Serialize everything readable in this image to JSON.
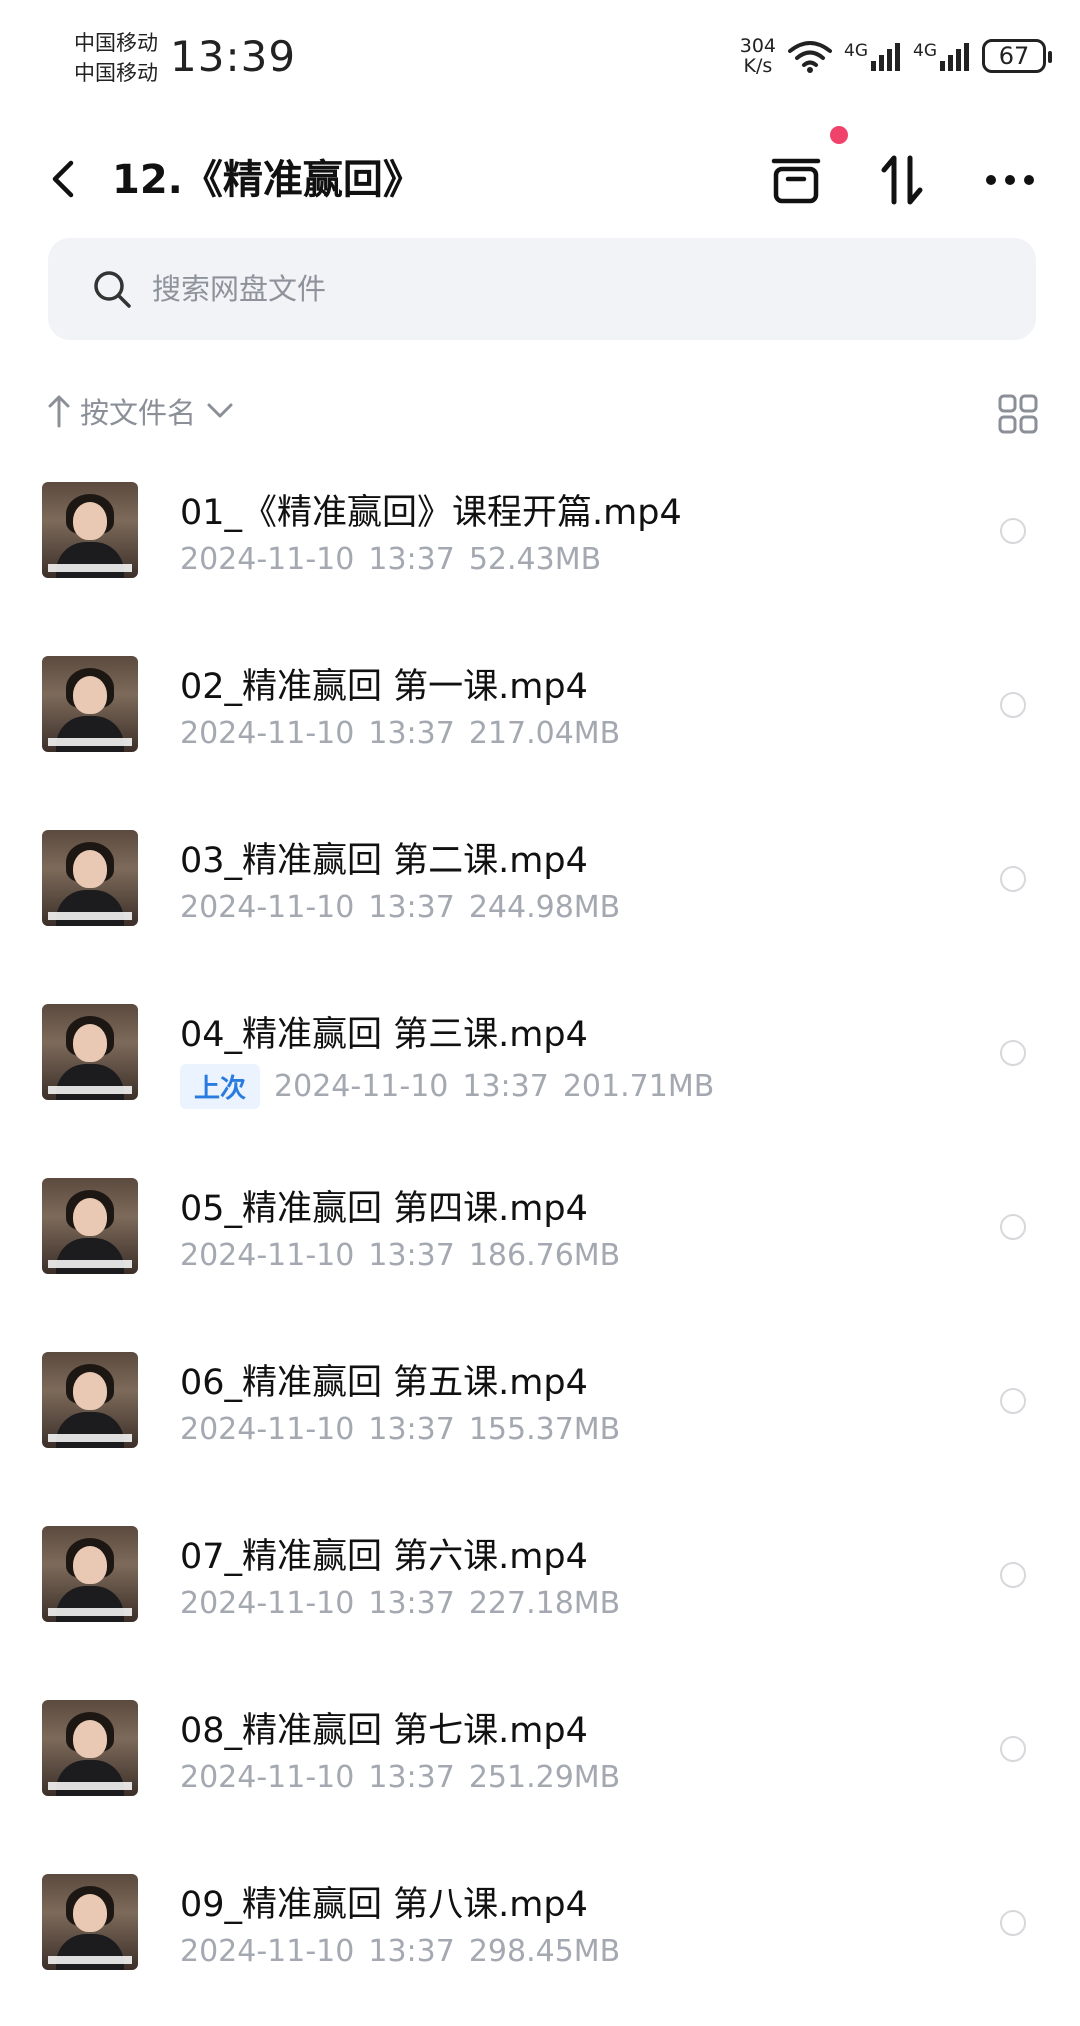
{
  "status_bar": {
    "carrier1": "中国移动",
    "carrier2": "中国移动",
    "time": "13:39",
    "net_speed_value": "304",
    "net_speed_unit": "K/s",
    "signal1": "4G",
    "signal2": "4G",
    "battery": "67"
  },
  "header": {
    "title": "12.《精准赢回》",
    "back_icon": "chevron-left-icon",
    "actions": [
      "archive-icon",
      "sort-arrows-icon",
      "more-icon"
    ]
  },
  "search": {
    "placeholder": "搜索网盘文件"
  },
  "sort": {
    "label": "按文件名"
  },
  "colors": {
    "badge_text": "#2a7be0",
    "badge_bg": "#eaf3fe",
    "notification_dot": "#f0436b",
    "meta_text": "#a4a8b0"
  },
  "files": [
    {
      "name": "01_《精准赢回》课程开篇.mp4",
      "date": "2024-11-10",
      "time": "13:37",
      "size": "52.43MB",
      "badge": ""
    },
    {
      "name": "02_精准赢回 第一课.mp4",
      "date": "2024-11-10",
      "time": "13:37",
      "size": "217.04MB",
      "badge": ""
    },
    {
      "name": "03_精准赢回 第二课.mp4",
      "date": "2024-11-10",
      "time": "13:37",
      "size": "244.98MB",
      "badge": ""
    },
    {
      "name": "04_精准赢回 第三课.mp4",
      "date": "2024-11-10",
      "time": "13:37",
      "size": "201.71MB",
      "badge": "上次"
    },
    {
      "name": "05_精准赢回 第四课.mp4",
      "date": "2024-11-10",
      "time": "13:37",
      "size": "186.76MB",
      "badge": ""
    },
    {
      "name": "06_精准赢回 第五课.mp4",
      "date": "2024-11-10",
      "time": "13:37",
      "size": "155.37MB",
      "badge": ""
    },
    {
      "name": "07_精准赢回 第六课.mp4",
      "date": "2024-11-10",
      "time": "13:37",
      "size": "227.18MB",
      "badge": ""
    },
    {
      "name": "08_精准赢回 第七课.mp4",
      "date": "2024-11-10",
      "time": "13:37",
      "size": "251.29MB",
      "badge": ""
    },
    {
      "name": "09_精准赢回 第八课.mp4",
      "date": "2024-11-10",
      "time": "13:37",
      "size": "298.45MB",
      "badge": ""
    }
  ]
}
